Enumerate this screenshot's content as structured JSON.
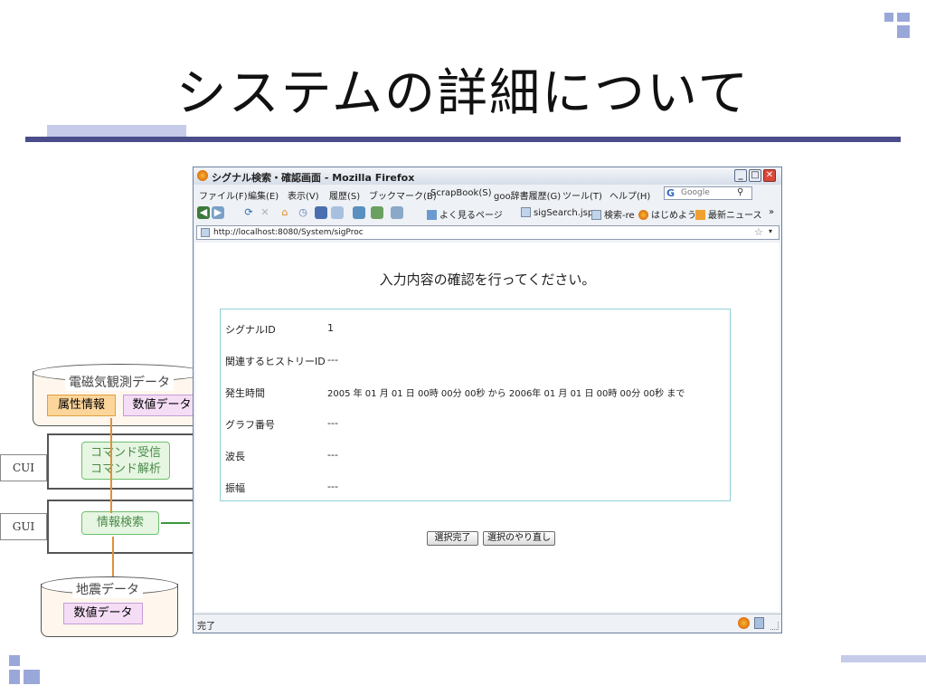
{
  "slide": {
    "title": "システムの詳細について"
  },
  "diagram": {
    "db_top_label": "電磁気観測データ",
    "attr_box": "属性情報",
    "numeric_box": "数値データ",
    "cmd_line1": "コマンド受信",
    "cmd_line2": "コマンド解析",
    "cui_label": "CUI",
    "gui_label": "GUI",
    "search_box": "情報検索",
    "db_bottom_label": "地震データ",
    "numeric_box2": "数値データ"
  },
  "browser": {
    "window_title": "シグナル検索・確認画面 - Mozilla Firefox",
    "menu": [
      "ファイル(F)",
      "編集(E)",
      "表示(V)",
      "履歴(S)",
      "ブックマーク(B)",
      "ScrapBook(S)",
      "goo辞書履歴(G)",
      "ツール(T)",
      "ヘルプ(H)"
    ],
    "search_placeholder": "Google",
    "bookmarks": [
      "よく見るページ",
      "sigSearch.jsp",
      "検索-re",
      "はじめよう",
      "最新ニュース"
    ],
    "overflow": "»",
    "url": "http://localhost:8080/System/sigProc",
    "status_text": "完了"
  },
  "page": {
    "heading": "入力内容の確認を行ってください。",
    "rows": [
      {
        "label": "シグナルID",
        "value": "1"
      },
      {
        "label": "関連するヒストリーID",
        "value": "---"
      },
      {
        "label": "発生時間",
        "value": "2005 年 01 月 01 日 00時 00分 00秒 から 2006年 01 月 01 日 00時 00分 00秒 まで"
      },
      {
        "label": "グラフ番号",
        "value": "---"
      },
      {
        "label": "波長",
        "value": "---"
      },
      {
        "label": "振幅",
        "value": "---"
      }
    ],
    "confirm_button": "選択完了",
    "redo_button": "選択のやり直し"
  },
  "colors": {
    "accent_bar": "#4a4d8a",
    "accent_light": "#c5cbe9",
    "panel_border": "#8fd0d6"
  }
}
